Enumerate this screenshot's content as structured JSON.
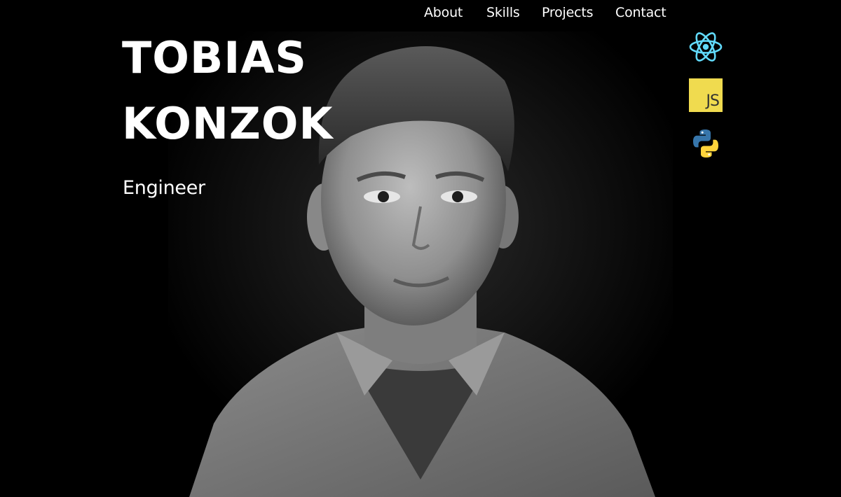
{
  "nav": {
    "items": [
      {
        "label": "About"
      },
      {
        "label": "Skills"
      },
      {
        "label": "Projects"
      },
      {
        "label": "Contact"
      }
    ]
  },
  "hero": {
    "first_name": "TOBIAS",
    "last_name": "KONZOK",
    "role": "Engineer"
  },
  "skills": {
    "icons": [
      {
        "name": "react-icon",
        "color": "#61dafb"
      },
      {
        "name": "javascript-icon",
        "label": "JS",
        "bg": "#f0db4f",
        "color": "#323330"
      },
      {
        "name": "python-icon",
        "colors": [
          "#3776ab",
          "#ffd43b"
        ]
      }
    ]
  },
  "colors": {
    "background": "#000000",
    "text": "#ffffff"
  }
}
